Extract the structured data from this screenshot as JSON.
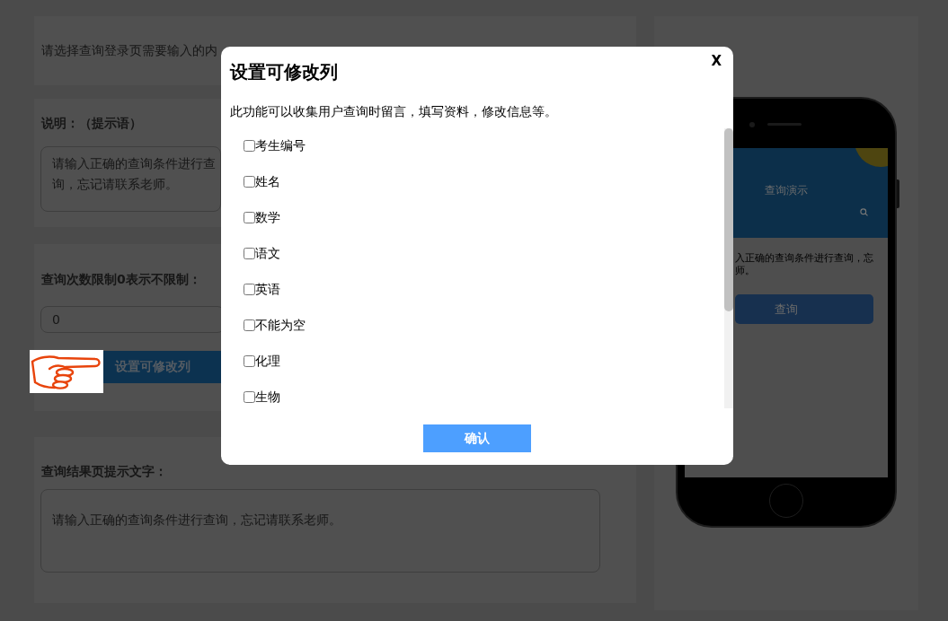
{
  "form": {
    "login_prompt": "请选择查询登录页需要输入的内",
    "notice": {
      "label": "说明：（提示语）",
      "value": "请输入正确的查询条件进行查询，忘记请联系老师。"
    },
    "query_limit": {
      "label": "查询次数限制0表示不限制：",
      "value": "0",
      "button": "设置可修改列"
    },
    "result_text": {
      "label": "查询结果页提示文字：",
      "value": "请输入正确的查询条件进行查询，忘记请联系老师。"
    }
  },
  "preview": {
    "title": "查询演示",
    "notice_lines": [
      "入正确的查询条件进行查询，忘",
      "师。"
    ],
    "button": "查询"
  },
  "modal": {
    "title": "设置可修改列",
    "close": "X",
    "description": "此功能可以收集用户查询时留言，填写资料，修改信息等。",
    "options": [
      {
        "label": "考生编号",
        "checked": false
      },
      {
        "label": "姓名",
        "checked": false
      },
      {
        "label": "数学",
        "checked": false
      },
      {
        "label": "语文",
        "checked": false
      },
      {
        "label": "英语",
        "checked": false
      },
      {
        "label": "不能为空",
        "checked": false
      },
      {
        "label": "化理",
        "checked": false
      },
      {
        "label": "生物",
        "checked": false
      }
    ],
    "confirm": "确认"
  }
}
